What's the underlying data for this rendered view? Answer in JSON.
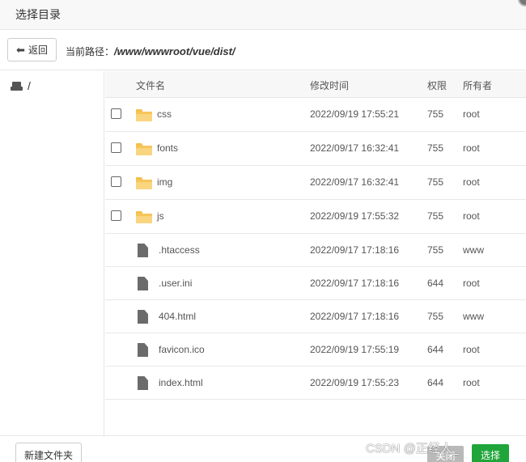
{
  "dialog": {
    "title": "选择目录"
  },
  "pathbar": {
    "back_label": "返回",
    "path_label": "当前路径：",
    "path_value": "/www/wwwroot/vue/dist/"
  },
  "tree": {
    "root_label": "/"
  },
  "table": {
    "headers": {
      "name": "文件名",
      "mtime": "修改时间",
      "perm": "权限",
      "owner": "所有者"
    },
    "rows": [
      {
        "type": "folder",
        "name": "css",
        "mtime": "2022/09/19 17:55:21",
        "perm": "755",
        "owner": "root"
      },
      {
        "type": "folder",
        "name": "fonts",
        "mtime": "2022/09/17 16:32:41",
        "perm": "755",
        "owner": "root"
      },
      {
        "type": "folder",
        "name": "img",
        "mtime": "2022/09/17 16:32:41",
        "perm": "755",
        "owner": "root"
      },
      {
        "type": "folder",
        "name": "js",
        "mtime": "2022/09/19 17:55:32",
        "perm": "755",
        "owner": "root"
      },
      {
        "type": "file",
        "name": ".htaccess",
        "mtime": "2022/09/17 17:18:16",
        "perm": "755",
        "owner": "www"
      },
      {
        "type": "file",
        "name": ".user.ini",
        "mtime": "2022/09/17 17:18:16",
        "perm": "644",
        "owner": "root"
      },
      {
        "type": "file",
        "name": "404.html",
        "mtime": "2022/09/17 17:18:16",
        "perm": "755",
        "owner": "www"
      },
      {
        "type": "file",
        "name": "favicon.ico",
        "mtime": "2022/09/19 17:55:19",
        "perm": "644",
        "owner": "root"
      },
      {
        "type": "file",
        "name": "index.html",
        "mtime": "2022/09/19 17:55:23",
        "perm": "644",
        "owner": "root"
      }
    ]
  },
  "footer": {
    "new_folder_label": "新建文件夹",
    "close_label": "关闭",
    "select_label": "选择",
    "watermark": "CSDN @正经人_"
  },
  "icons": {
    "back": "arrow-left-icon",
    "root": "disk-icon",
    "folder": "folder-icon",
    "file": "file-icon"
  },
  "colors": {
    "select_button": "#20a53a",
    "close_button": "#b9b9b9",
    "folder": "#f6c55a",
    "file": "#6b6b6b"
  }
}
